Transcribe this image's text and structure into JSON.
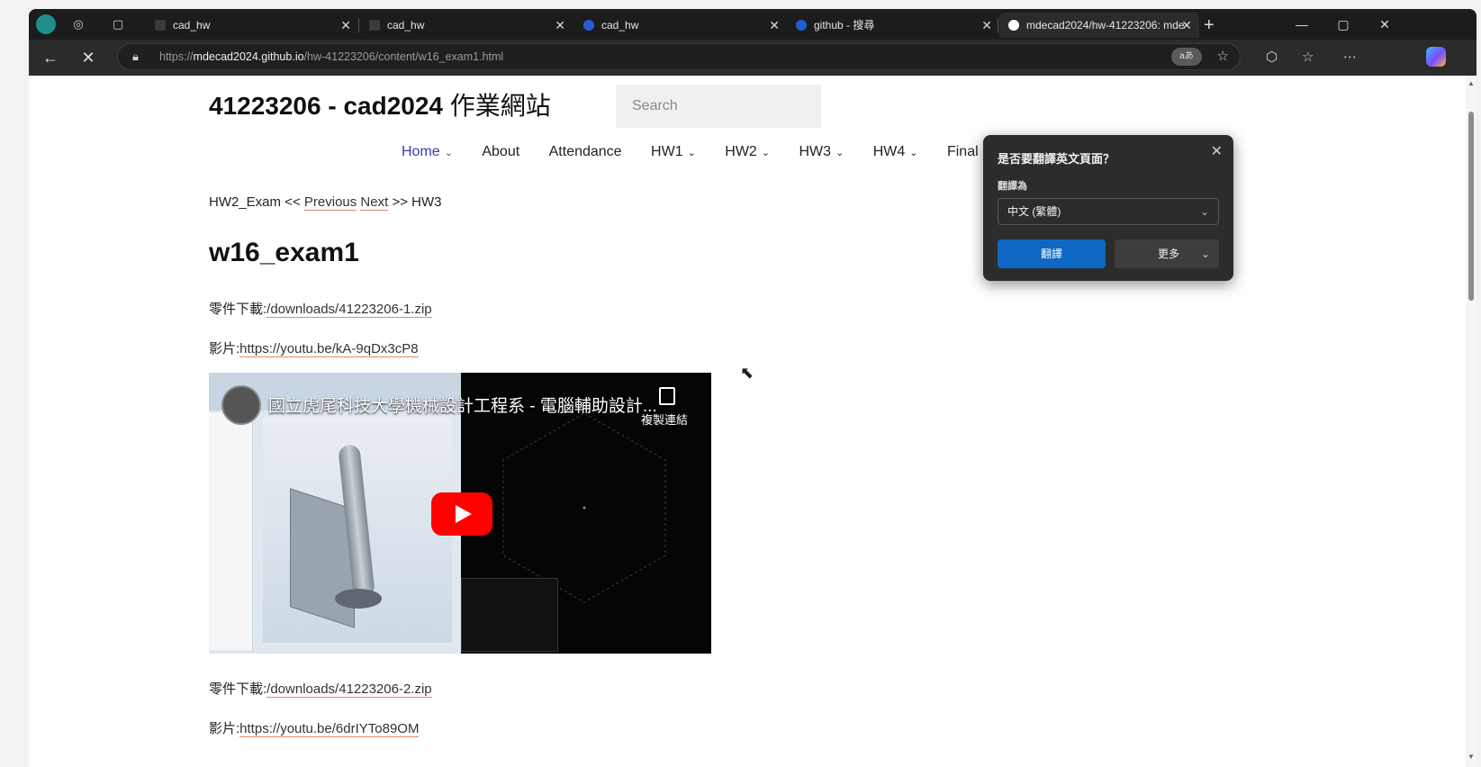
{
  "tabs": [
    {
      "title": "cad_hw",
      "active": false,
      "fav_color": "#3a3a3a"
    },
    {
      "title": "cad_hw",
      "active": false,
      "fav_color": "#3a3a3a"
    },
    {
      "title": "cad_hw",
      "active": false,
      "fav_color": "#2b5dd8"
    },
    {
      "title": "github - 搜尋",
      "active": false,
      "fav_color": "#1e5fd1"
    },
    {
      "title": "mdecad2024/hw-41223206: mde",
      "active": true,
      "fav_color": "#ffffff"
    }
  ],
  "address_bar": {
    "url_prefix": "https://",
    "url_domain": "mdecad2024.github.io",
    "url_path": "/hw-41223206/content/w16_exam1.html",
    "translate_chip": "aあ"
  },
  "site": {
    "title": "41223206 - cad2024",
    "title_zh": "作業網站",
    "search_placeholder": "Search",
    "nav": [
      "Home",
      "About",
      "Attendance",
      "HW1",
      "HW2",
      "HW3",
      "HW4",
      "Final Re"
    ]
  },
  "breadcrumb": {
    "prefix": "HW2_Exam <<",
    "previous": "Previous",
    "next": "Next",
    "suffix": ">> HW3"
  },
  "content": {
    "heading": "w16_exam1",
    "part1_label": "零件下載:",
    "part1_link": "/downloads/41223206-1.zip",
    "video1_label": "影片:",
    "video1_link": "https://youtu.be/kA-9qDx3cP8",
    "part2_label": "零件下載:",
    "part2_link": "/downloads/41223206-2.zip",
    "video2_label": "影片:",
    "video2_link": "https://youtu.be/6drIYTo89OM"
  },
  "video": {
    "title": "國立虎尾科技大學機械設計工程系 - 電腦輔助設計...",
    "copy_link_label": "複製連結"
  },
  "translate_popup": {
    "title": "是否要翻譯英文頁面？",
    "translate_to_label": "翻譯為",
    "selected_language": "中文 (繁體)",
    "translate_button": "翻譯",
    "more_button": "更多"
  }
}
